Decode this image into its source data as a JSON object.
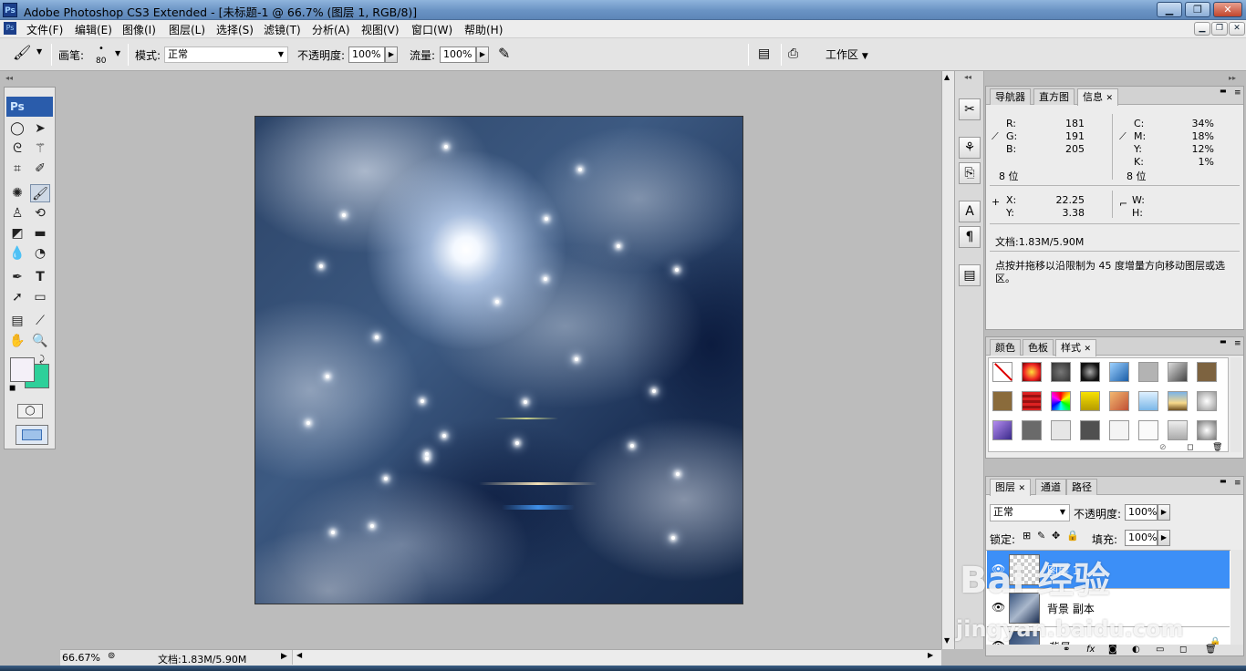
{
  "window": {
    "title": "Adobe Photoshop CS3 Extended - [未标题-1 @ 66.7% (图层 1, RGB/8)]",
    "logo": "Ps",
    "buttons": [
      "minimize",
      "restore",
      "close"
    ]
  },
  "menu": [
    "文件(F)",
    "编辑(E)",
    "图像(I)",
    "图层(L)",
    "选择(S)",
    "滤镜(T)",
    "分析(A)",
    "视图(V)",
    "窗口(W)",
    "帮助(H)"
  ],
  "options": {
    "brush_label": "画笔:",
    "brush_size": "80",
    "mode_label": "模式:",
    "mode_value": "正常",
    "opacity_label": "不透明度:",
    "opacity_value": "100%",
    "flow_label": "流量:",
    "flow_value": "100%",
    "workspace_label": "工作区"
  },
  "toolbox": {
    "logo": "Ps",
    "tools": [
      "marquee-icon",
      "move-icon",
      "lasso-icon",
      "magic-wand-icon",
      "crop-icon",
      "slice-icon",
      "healing-icon",
      "brush-icon",
      "stamp-icon",
      "history-brush-icon",
      "eraser-icon",
      "gradient-icon",
      "blur-icon",
      "dodge-icon",
      "pen-icon",
      "type-icon",
      "path-select-icon",
      "shape-icon",
      "notes-icon",
      "eyedropper-icon",
      "hand-icon",
      "zoom-icon"
    ],
    "foreground_color": "#f4f0f8",
    "background_color": "#2ed09a"
  },
  "status": {
    "zoom": "66.67%",
    "doc": "文档:1.83M/5.90M"
  },
  "info_panel": {
    "tabs": [
      "导航器",
      "直方图",
      "信息"
    ],
    "r_label": "R:",
    "r": "181",
    "g_label": "G:",
    "g": "191",
    "b_label": "B:",
    "b": "205",
    "c_label": "C:",
    "c": "34%",
    "m_label": "M:",
    "m": "18%",
    "y_label": "Y:",
    "y": "12%",
    "k_label": "K:",
    "k": "1%",
    "bits_left": "8 位",
    "bits_right": "8 位",
    "x_label": "X:",
    "x": "22.25",
    "yy_label": "Y:",
    "yy": "3.38",
    "w_label": "W:",
    "h_label": "H:",
    "doc": "文档:1.83M/5.90M",
    "hint": "点按并拖移以沿限制为 45 度增量方向移动图层或选区。"
  },
  "styles_panel": {
    "tabs": [
      "颜色",
      "色板",
      "样式"
    ]
  },
  "layers_panel": {
    "tabs": [
      "图层",
      "通道",
      "路径"
    ],
    "blend_mode": "正常",
    "opacity_label": "不透明度:",
    "opacity": "100%",
    "lock_label": "锁定:",
    "fill_label": "填充:",
    "fill": "100%",
    "layers": [
      {
        "name": "图层 1",
        "selected": true
      },
      {
        "name": "背景 副本",
        "selected": false
      },
      {
        "name": "背景",
        "selected": false
      }
    ]
  },
  "watermark": {
    "main": "Bai 经验",
    "url": "jingyan.baidu.com"
  }
}
